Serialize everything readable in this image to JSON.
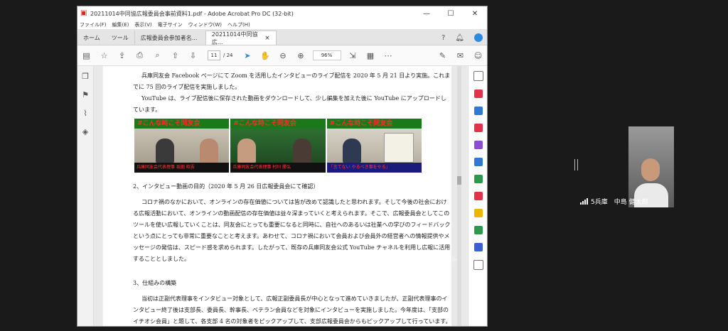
{
  "window": {
    "title": "20211014中同協広報委員会事前資料1.pdf - Adobe Acrobat Pro DC (32-bit)",
    "min_label": "—",
    "max_label": "☐",
    "close_label": "✕"
  },
  "menu": [
    "ファイル(F)",
    "編集(E)",
    "表示(V)",
    "電子サイン",
    "ウィンドウ(W)",
    "ヘルプ(H)"
  ],
  "tabs": {
    "home": "ホーム",
    "tools": "ツール",
    "doc1": "広報委員会参加者名...",
    "doc2": "20211014中同協広...",
    "close": "×"
  },
  "toolbar": {
    "page_current": "11",
    "page_total": "/ 24",
    "zoom": "96%"
  },
  "doc": {
    "p1": "兵庫同友会 Facebook ページにて Zoom を活用したインタビューのライブ配信を 2020 年 5 月 21 日より実施。これまでに 75 回のライブ配信を実施しました。",
    "p2": "YouTube は、ライブ配信後に保存された動画をダウンロードして、少し編集を加えた後に YouTube にアップロードしています。",
    "photos": [
      {
        "header": "#こんな時こそ同友会",
        "caption": "兵庫同友会代表理事 坂田 昭吾"
      },
      {
        "header": "#こんな時こそ同友会",
        "caption": "兵庫同友会代表理事 村川 勝弘"
      },
      {
        "header": "#こんな時こそ同友会",
        "caption": "「言てない やるべき事をやる」"
      }
    ],
    "h2": "2、インタビュー動画の目的（2020 年 5 月 26 日広報委員会にて確認）",
    "p3": "コロナ禍のなかにおいて、オンラインの存在価値については皆が改めて認識したと思われます。そして今後の社会における広報活動において、オンラインの動画配信の存在価値は益々深まっていくと考えられます。そこで、広報委員会としてこのツールを使い広報していくことは、同友会にとっても重要になると同時に、自社へのあるいは社業への学びのフィードバックという点にとっても非常に重要なことと考えます。あわせて、コロナ禍において会員および会員外の経営者への情報提供やメッセージの発信は、スピード感を求められます。したがって、既存の兵庫同友会公式 YouTube チャネルを利用し広報に活用することとしました。",
    "h3": "3、仕組みの構築",
    "p4": "当初は正副代表理事をインタビュー対象として、広報正副委員長が中心となって進めていきましたが、正副代表理事のインタビュー終了後は支部長、委員長、幹事長、ベテラン会員などを対象にインタビューを実施しました。今年度は、「支部のイチオシ会員」と題して、各支部 4 名の対象者をピックアップして、支部広報委員会からもピックアップして行っています。"
  },
  "participant": {
    "label": "5兵庫　中島 健太郎"
  },
  "colors": {
    "accent_red": "#d4281e",
    "acrobat_blue": "#2c8be0"
  }
}
